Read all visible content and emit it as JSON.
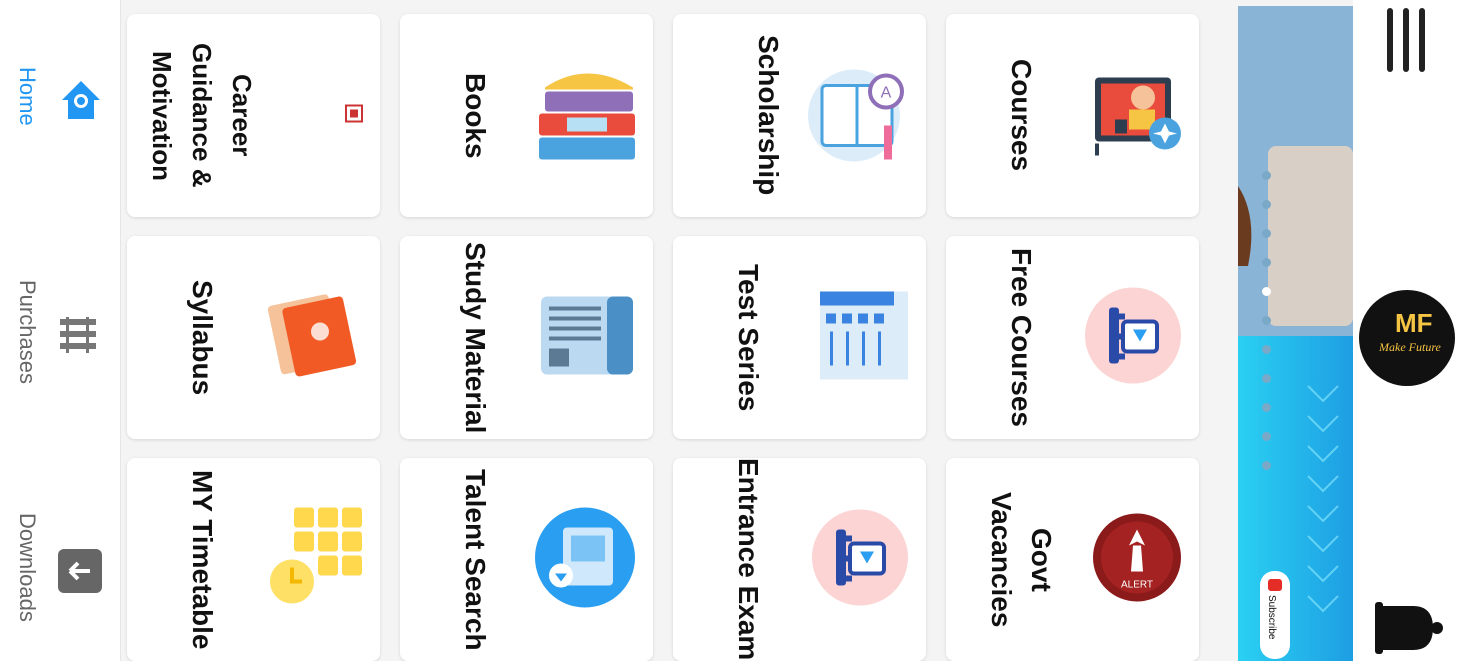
{
  "nav": {
    "items": [
      {
        "label": "Home",
        "icon": "home-icon",
        "active": true
      },
      {
        "label": "Purchases",
        "icon": "purchases-icon",
        "active": false
      },
      {
        "label": "Downloads",
        "icon": "downloads-icon",
        "active": false
      }
    ]
  },
  "cards": [
    {
      "label": "Career Guidance & Motivation",
      "icon": "career-icon"
    },
    {
      "label": "Books",
      "icon": "books-icon"
    },
    {
      "label": "Scholarship",
      "icon": "scholarship-icon"
    },
    {
      "label": "Courses",
      "icon": "courses-icon"
    },
    {
      "label": "Syllabus",
      "icon": "syllabus-icon"
    },
    {
      "label": "Study Material",
      "icon": "study-material-icon"
    },
    {
      "label": "Test Series",
      "icon": "test-series-icon"
    },
    {
      "label": "Free Courses",
      "icon": "free-courses-icon"
    },
    {
      "label": "MY Timetable",
      "icon": "timetable-icon"
    },
    {
      "label": "Talent Search",
      "icon": "talent-search-icon"
    },
    {
      "label": "Entrance Exam",
      "icon": "entrance-exam-icon"
    },
    {
      "label": "Govt Vacancies",
      "icon": "govt-vacancies-icon"
    }
  ],
  "banner": {
    "subscribe": "Subscribe",
    "slides": 10,
    "active_slide": 5
  },
  "logo": {
    "text": "Make Future"
  },
  "colors": {
    "accent": "#2196f3",
    "banner": "#1eaee8"
  }
}
